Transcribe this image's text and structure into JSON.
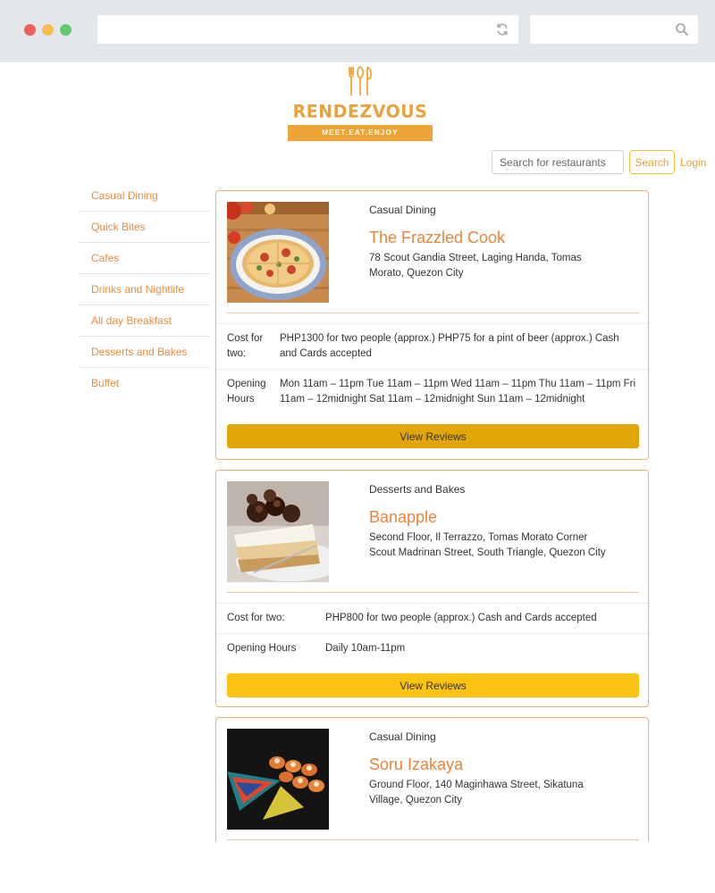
{
  "browser": {
    "window_controls": [
      "close",
      "minimize",
      "maximize"
    ],
    "url_value": "",
    "search_value": "",
    "icons": {
      "reload": "reload-icon",
      "search": "search-icon"
    }
  },
  "logo": {
    "brand": "RENDEZVOUS",
    "tagline": "MEET.EAT.ENJOY",
    "icon": "utensils-icon",
    "color": "#efa535"
  },
  "header": {
    "search_placeholder": "Search for restaurants",
    "search_button": "Search",
    "login": "Login"
  },
  "sidebar": {
    "items": [
      {
        "label": "Casual Dining"
      },
      {
        "label": "Quick Bites"
      },
      {
        "label": "Cafes"
      },
      {
        "label": "Drinks and Nightlife"
      },
      {
        "label": "All day Breakfast"
      },
      {
        "label": "Desserts and Bakes"
      },
      {
        "label": "Buffet"
      }
    ]
  },
  "restaurants": [
    {
      "category": "Casual Dining",
      "name": "The Frazzled Cook",
      "address": "78 Scout Gandia Street, Laging Handa, Tomas Morato, Quezon City",
      "cost_label": "Cost for two:",
      "cost_value": "PHP1300 for two people (approx.) PHP75 for a pint of beer (approx.) Cash and Cards accepted",
      "hours_label": "Opening Hours",
      "hours_value": "Mon 11am – 11pm Tue 11am – 11pm Wed 11am – 11pm Thu 11am – 11pm Fri 11am – 12midnight Sat 11am – 12midnight Sun 11am – 12midnight",
      "button": "View Reviews",
      "image": "pizza-photo"
    },
    {
      "category": "Desserts and Bakes",
      "name": "Banapple",
      "address": "Second Floor, Il Terrazzo, Tomas Morato Corner Scout Madrinan Street, South Triangle, Quezon City",
      "cost_label": "Cost for two:",
      "cost_value": "PHP800 for two people (approx.) Cash and Cards accepted",
      "hours_label": "Opening Hours",
      "hours_value": "Daily 10am-11pm",
      "button": "View Reviews",
      "image": "cake-photo"
    },
    {
      "category": "Casual Dining",
      "name": "Soru Izakaya",
      "address": "Ground Floor, 140 Maginhawa Street, Sikatuna Village, Quezon City",
      "image": "sushi-photo"
    }
  ],
  "colors": {
    "accent": "#e8843a",
    "button_primary": "#fcc313",
    "button_hover": "#e0a705",
    "card_border": "#efb06a"
  }
}
